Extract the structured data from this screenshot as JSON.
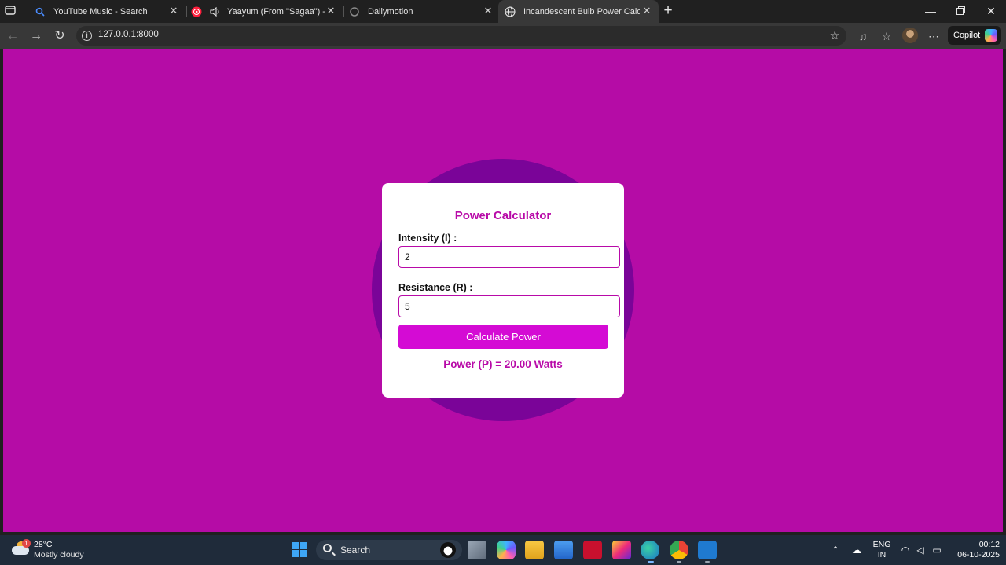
{
  "browser": {
    "tabs": [
      {
        "title": "YouTube Music - Search",
        "favicon": "search-icon"
      },
      {
        "title": "Yaayum (From \"Sagaa\") - You",
        "favicon": "youtube-music-icon"
      },
      {
        "title": "Dailymotion",
        "favicon": "dailymotion-icon"
      },
      {
        "title": "Incandescent Bulb Power Calculat",
        "favicon": "globe-icon",
        "active": true
      }
    ],
    "url": "127.0.0.1:8000",
    "copilot_label": "Copilot"
  },
  "page": {
    "title": "Power Calculator",
    "intensity_label": "Intensity (I) :",
    "intensity_value": "2",
    "resistance_label": "Resistance (R) :",
    "resistance_value": "5",
    "button_label": "Calculate Power",
    "result_text": "Power (P) = 20.00 Watts",
    "colors": {
      "background": "#b50ca6",
      "glow": "#7a0498",
      "accent": "#b80aa8",
      "button": "#d40bd4"
    }
  },
  "taskbar": {
    "weather_badge": "1",
    "weather_temp": "28°C",
    "weather_desc": "Mostly cloudy",
    "search_label": "Search",
    "lang_line1": "ENG",
    "lang_line2": "IN",
    "time": "00:12",
    "date": "06-10-2025"
  }
}
